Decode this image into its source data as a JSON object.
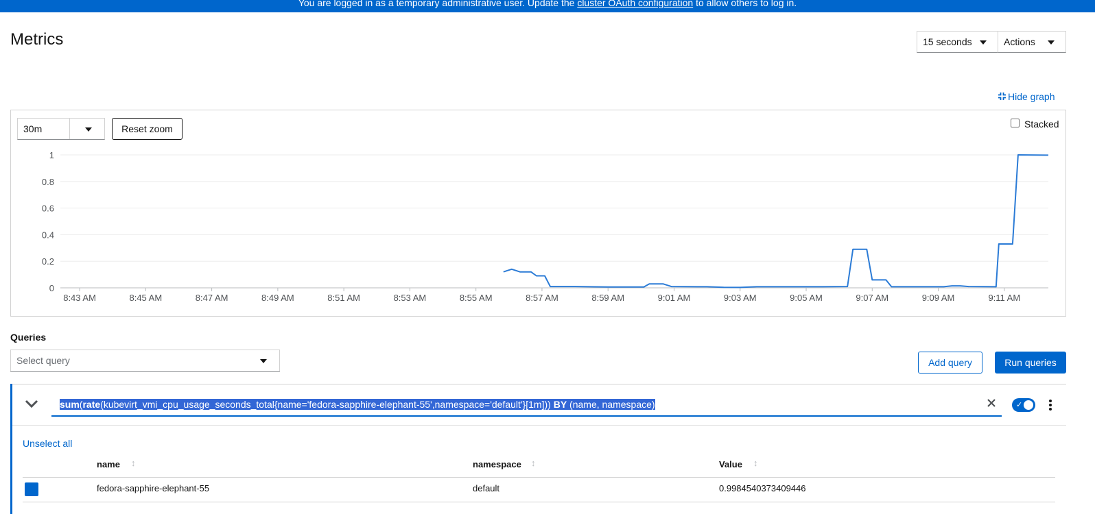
{
  "banner": {
    "text_before": "You are logged in as a temporary administrative user. Update the ",
    "link": "cluster OAuth configuration",
    "text_after": " to allow others to log in."
  },
  "page": {
    "title": "Metrics"
  },
  "header": {
    "refresh_interval": "15 seconds",
    "actions_label": "Actions"
  },
  "graph": {
    "hide_graph_label": "Hide graph",
    "time_range": "30m",
    "reset_zoom_label": "Reset zoom",
    "stacked_label": "Stacked",
    "stacked_checked": false
  },
  "chart_data": {
    "type": "line",
    "x_tick_labels": [
      "8:43 AM",
      "8:45 AM",
      "8:47 AM",
      "8:49 AM",
      "8:51 AM",
      "8:53 AM",
      "8:55 AM",
      "8:57 AM",
      "8:59 AM",
      "9:01 AM",
      "9:03 AM",
      "9:05 AM",
      "9:07 AM",
      "9:09 AM",
      "9:11 AM"
    ],
    "x_range_minutes": [
      "8:42:25",
      "9:12:20"
    ],
    "ylim": [
      0,
      1
    ],
    "y_ticks": [
      0,
      0.2,
      0.4,
      0.6,
      0.8,
      1
    ],
    "y_tick_labels": [
      "0",
      "0.2",
      "0.4",
      "0.6",
      "0.8",
      "1"
    ],
    "grid": true,
    "series": [
      {
        "color": "#2b7bd6",
        "points": [
          [
            "8:55:50",
            0.12
          ],
          [
            "8:56:05",
            0.14
          ],
          [
            "8:56:20",
            0.12
          ],
          [
            "8:56:40",
            0.12
          ],
          [
            "8:56:50",
            0.09
          ],
          [
            "8:57:05",
            0.09
          ],
          [
            "8:57:15",
            0.01
          ],
          [
            "8:58:00",
            0.01
          ],
          [
            "8:59:00",
            0.006
          ],
          [
            "9:00:05",
            0.006
          ],
          [
            "9:00:15",
            0.03
          ],
          [
            "9:00:40",
            0.03
          ],
          [
            "9:00:55",
            0.01
          ],
          [
            "9:02:00",
            0.008
          ],
          [
            "9:02:30",
            0.004
          ],
          [
            "9:03:00",
            0.003
          ],
          [
            "9:03:30",
            0.008
          ],
          [
            "9:05:30",
            0.008
          ],
          [
            "9:06:15",
            0.01
          ],
          [
            "9:06:25",
            0.29
          ],
          [
            "9:06:50",
            0.29
          ],
          [
            "9:07:00",
            0.06
          ],
          [
            "9:07:25",
            0.06
          ],
          [
            "9:07:35",
            0.008
          ],
          [
            "9:09:10",
            0.008
          ],
          [
            "9:09:25",
            0.015
          ],
          [
            "9:09:40",
            0.015
          ],
          [
            "9:09:55",
            0.01
          ],
          [
            "9:10:45",
            0.008
          ],
          [
            "9:10:50",
            0.33
          ],
          [
            "9:11:15",
            0.33
          ],
          [
            "9:11:25",
            1.0
          ],
          [
            "9:12:20",
            0.998
          ]
        ]
      }
    ]
  },
  "queries": {
    "label": "Queries",
    "select_placeholder": "Select query",
    "add_query_label": "Add query",
    "run_queries_label": "Run queries",
    "query": {
      "parts": [
        {
          "t": "sum",
          "b": true
        },
        {
          "t": "(",
          "b": false
        },
        {
          "t": "rate",
          "b": true
        },
        {
          "t": "(kubevirt_vmi_cpu_usage_seconds_total{name='fedora-sapphire-elephant-55',namespace='default'}[1m])) ",
          "b": false
        },
        {
          "t": "BY",
          "b": true
        },
        {
          "t": " (name, namespace)",
          "b": false
        }
      ],
      "enabled": true
    },
    "unselect_all_label": "Unselect all",
    "table": {
      "columns": [
        "name",
        "namespace",
        "Value"
      ],
      "rows": [
        {
          "name": "fedora-sapphire-elephant-55",
          "namespace": "default",
          "value": "0.9984540373409446",
          "color": "#0066cc"
        }
      ]
    }
  }
}
